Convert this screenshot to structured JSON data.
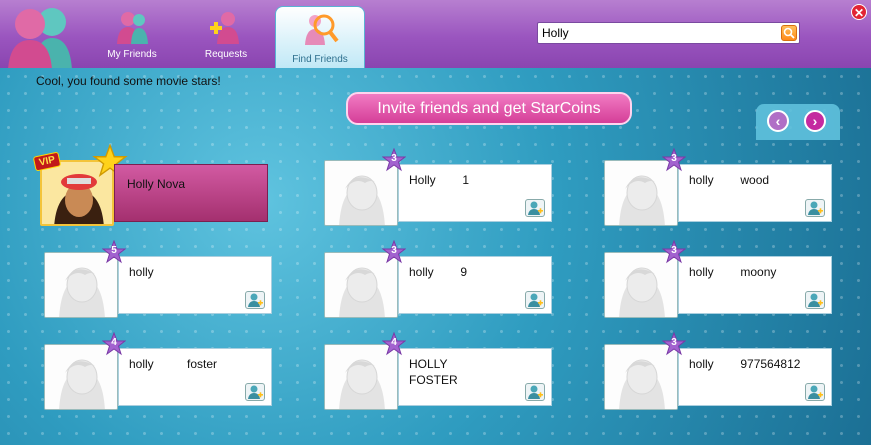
{
  "header": {
    "tabs": [
      {
        "label": "My Friends",
        "icon": "friends-icon",
        "active": false
      },
      {
        "label": "Requests",
        "icon": "requests-icon",
        "active": false
      },
      {
        "label": "Find Friends",
        "icon": "find-friends-icon",
        "active": true
      }
    ],
    "search": {
      "value": "Holly",
      "icon": "search-icon"
    },
    "close_icon": "close-icon"
  },
  "main": {
    "message": "Cool, you found some movie stars!",
    "invite_label": "Invite friends and get StarCoins",
    "pager": {
      "prev": "chevron-left-icon",
      "next": "chevron-right-icon"
    },
    "featured": {
      "name": "Holly Nova",
      "vip": "VIP"
    },
    "results": [
      {
        "name": "Holly        1",
        "level": "3"
      },
      {
        "name": "holly        wood",
        "level": "3"
      },
      {
        "name": "holly",
        "level": "5"
      },
      {
        "name": "holly        9",
        "level": "3"
      },
      {
        "name": "holly        moony",
        "level": "3"
      },
      {
        "name": "holly          foster",
        "level": "4"
      },
      {
        "name": "HOLLY\nFOSTER",
        "level": "4"
      },
      {
        "name": "holly        977564812",
        "level": "3"
      }
    ]
  },
  "colors": {
    "accent_purple": "#9a55bf",
    "invite_pink": "#d53e98",
    "background_blue": "#2f9cc0"
  }
}
